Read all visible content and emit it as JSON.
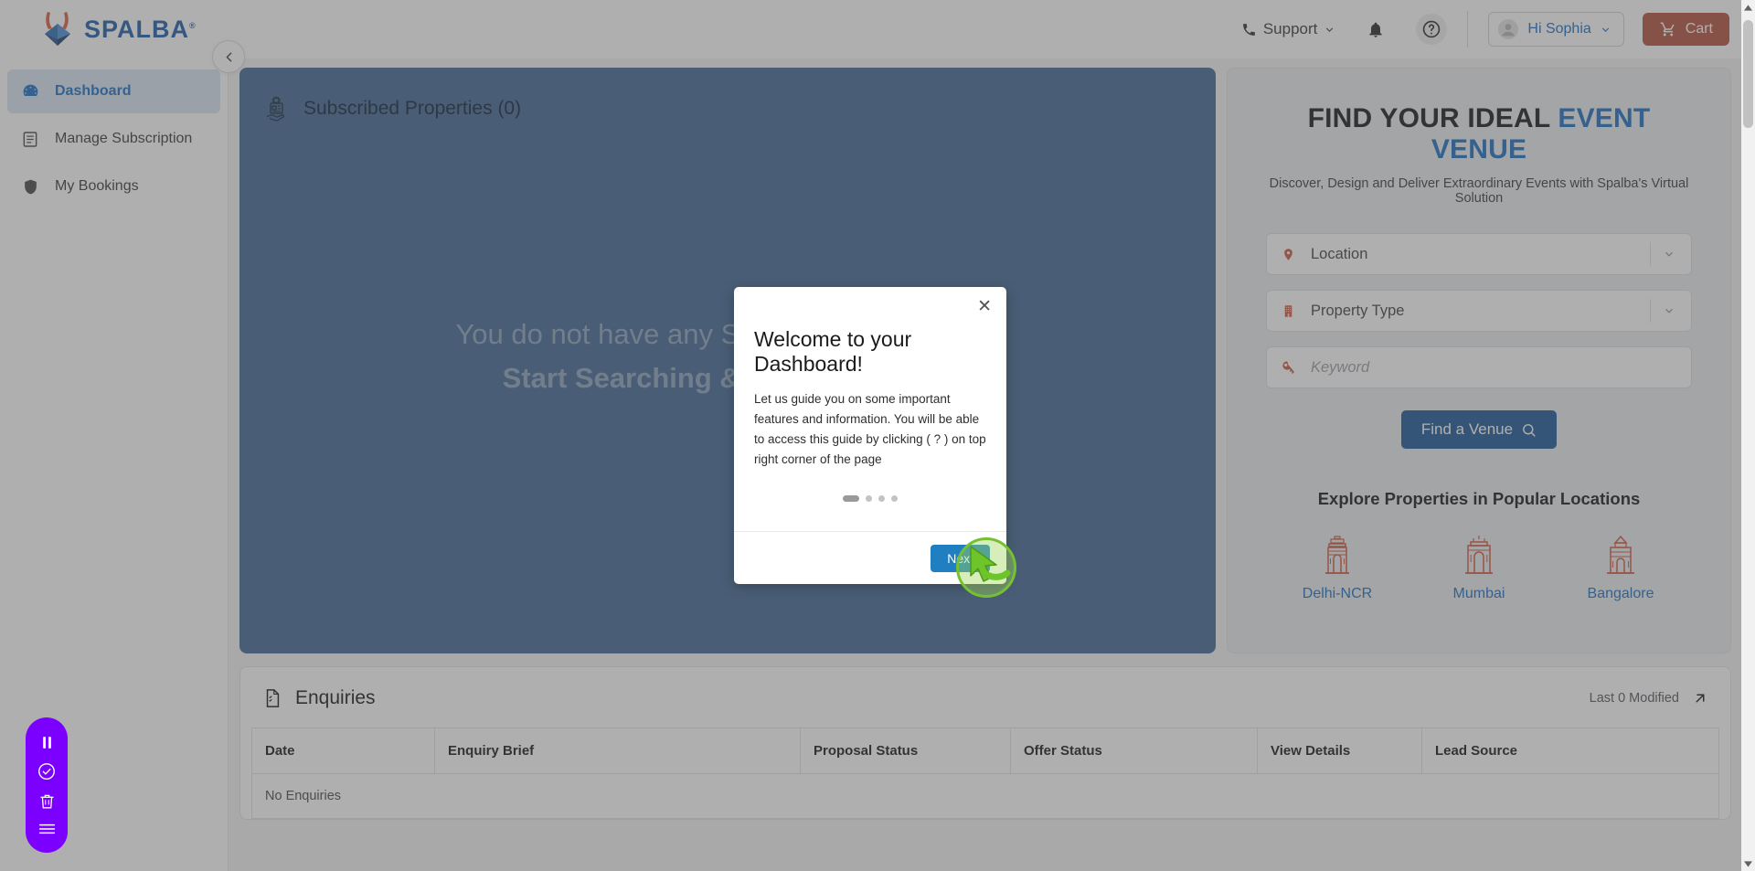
{
  "header": {
    "logo_text": "SPALBA",
    "logo_tm": "®",
    "support_label": "Support",
    "support_icon": "phone-icon",
    "bell_icon": "notification-bell-icon",
    "help_icon": "help-question-icon",
    "user_greeting": "Hi Sophia",
    "user_icon": "avatar-icon",
    "cart_label": "Cart",
    "cart_icon": "shopping-cart-icon"
  },
  "sidebar": {
    "collapse_icon": "chevron-left-icon",
    "items": [
      {
        "label": "Dashboard",
        "icon": "dashboard-gauge-icon",
        "active": true
      },
      {
        "label": "Manage Subscription",
        "icon": "clipboard-list-icon",
        "active": false
      },
      {
        "label": "My Bookings",
        "icon": "shield-icon",
        "active": false
      }
    ]
  },
  "subscribed_card": {
    "icon": "subscribed-property-hand-icon",
    "title": "Subscribed Properties (0)",
    "empty_line1": "You do not have any Subscribed Properties",
    "empty_line2": "Start Searching & Subscribe Now"
  },
  "search_panel": {
    "title_black": "FIND YOUR IDEAL",
    "title_blue": "EVENT VENUE",
    "subtitle": "Discover, Design and Deliver Extraordinary Events with Spalba's Virtual Solution",
    "fields": [
      {
        "name": "location",
        "label": "Location",
        "icon": "map-pin-icon",
        "caret": "chevron-down-icon",
        "placeholder": false
      },
      {
        "name": "property-type",
        "label": "Property Type",
        "icon": "building-icon",
        "caret": "chevron-down-icon",
        "placeholder": false
      },
      {
        "name": "keyword",
        "label": "Keyword",
        "icon": "key-icon",
        "caret": "",
        "placeholder": true
      }
    ],
    "find_button": "Find a Venue",
    "find_button_icon": "search-magnifier-icon",
    "explore_title": "Explore Properties in Popular Locations",
    "locations": [
      {
        "name": "Delhi-NCR",
        "icon": "india-gate-icon"
      },
      {
        "name": "Mumbai",
        "icon": "gateway-of-india-icon"
      },
      {
        "name": "Bangalore",
        "icon": "vidhana-soudha-icon"
      }
    ]
  },
  "enquiries": {
    "icon": "document-check-icon",
    "title": "Enquiries",
    "last_modified": "Last 0 Modified",
    "expand_icon": "arrow-up-right-icon",
    "columns": [
      "Date",
      "Enquiry Brief",
      "Proposal Status",
      "Offer Status",
      "View Details",
      "Lead Source"
    ],
    "empty_message": "No Enquiries"
  },
  "float_toolbar": {
    "items": [
      {
        "name": "pause",
        "icon": "pause-icon"
      },
      {
        "name": "finish",
        "icon": "check-circle-icon"
      },
      {
        "name": "delete",
        "icon": "trash-icon"
      },
      {
        "name": "menu",
        "icon": "hamburger-menu-icon"
      }
    ]
  },
  "modal": {
    "close_icon": "close-x-icon",
    "title": "Welcome to your Dashboard!",
    "text": "Let us guide you on some important features and information. You will be able to access this guide by clicking ( ? ) on top right corner of the page",
    "dots_total": 4,
    "dots_active_index": 0,
    "next_label": "Next"
  },
  "colors": {
    "brand_blue": "#1f6fc4",
    "accent_red": "#c8453a",
    "card_blue": "#436a96",
    "cart_brown": "#b3543f",
    "find_btn_blue": "#1d5a9a",
    "next_btn_blue": "#1f7fc0",
    "toolbar_purple": "#7b00ff",
    "cursor_green": "#76c132"
  }
}
